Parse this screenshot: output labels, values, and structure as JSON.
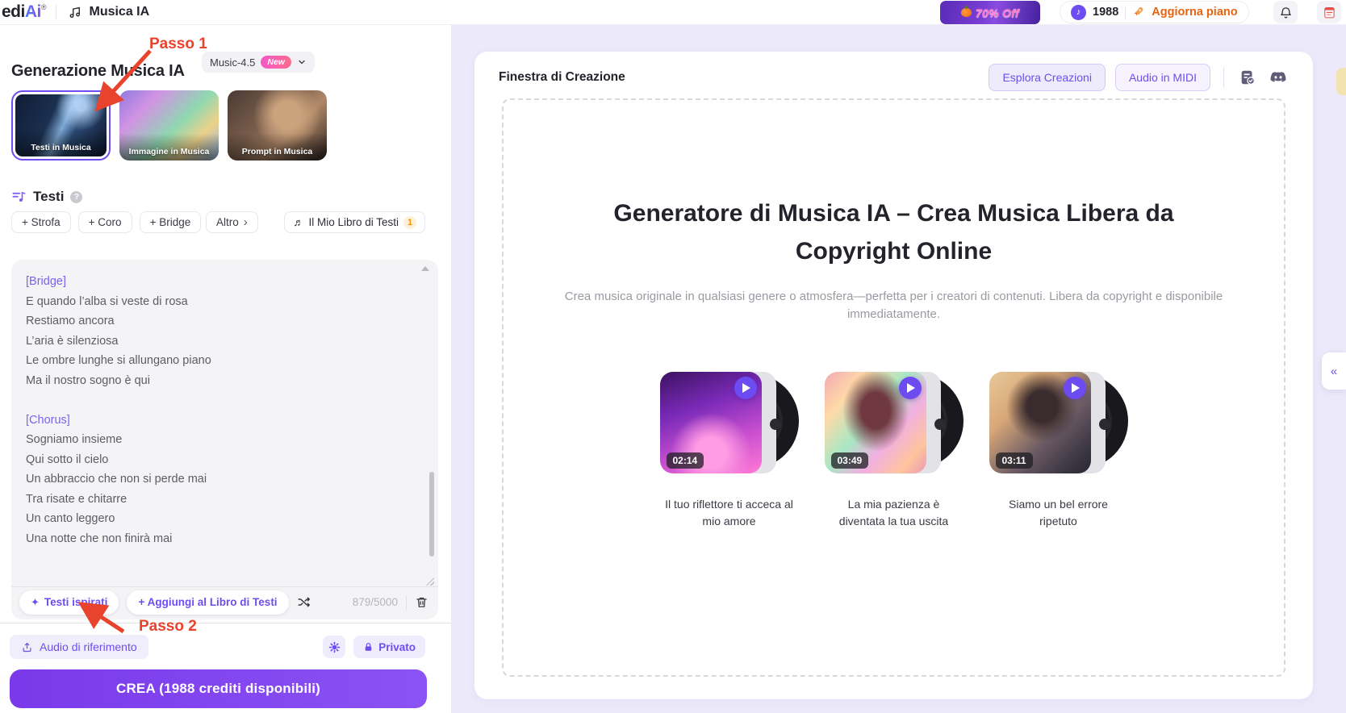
{
  "colors": {
    "accent": "#6d4df2",
    "annotation_red": "#e8432d",
    "upgrade_orange": "#e8630f",
    "promo_pink": "#ff6fc8",
    "lavender_bg": "#ebe9fa"
  },
  "topbar": {
    "logo_prefix": "edi",
    "logo_accent": "Ai",
    "logo_reg": "®",
    "app_title": "Musica IA",
    "promo_label": "70% Off",
    "credits": "1988",
    "upgrade_label": "Aggiorna piano",
    "note_glyph": "♪"
  },
  "sidebar": {
    "step1_label": "Passo 1",
    "step2_label": "Passo 2",
    "heading": "Generazione Musica IA",
    "model_name": "Music-4.5",
    "model_badge": "New",
    "modes": [
      "Testi in Musica",
      "Immagine in Musica",
      "Prompt in Musica"
    ],
    "section_title": "Testi",
    "help_glyph": "?",
    "chips": [
      "+ Strofa",
      "+ Coro",
      "+ Bridge"
    ],
    "more_label": "Altro",
    "more_chevron": "›",
    "library_label": "Il Mio Libro di Testi",
    "library_count": "1",
    "library_icon_glyph": "♬",
    "lyrics_lines": [
      "[Bridge]",
      "E quando l’alba si veste di rosa",
      "Restiamo ancora",
      "L’aria è silenziosa",
      "Le ombre lunghe si allungano piano",
      "Ma il nostro sogno è qui",
      "",
      "[Chorus]",
      "Sogniamo insieme",
      "Qui sotto il cielo",
      "Un abbraccio che non si perde mai",
      "Tra risate e chitarre",
      "Un canto leggero",
      "Una notte che non finirà mai"
    ],
    "char_counter": "879/5000",
    "inspired_icon": "✦",
    "inspired_label": "Testi ispirati",
    "add_library_label": "+ Aggiungi al Libro di Testi",
    "reference_label": "Audio di riferimento",
    "private_label": "Privato",
    "create_label": "CREA (1988 crediti disponibili)"
  },
  "main": {
    "window_title": "Finestra di Creazione",
    "explore_label": "Esplora Creazioni",
    "midi_label": "Audio in MIDI",
    "hero_title": "Generatore di Musica IA – Crea Musica Libera da Copyright Online",
    "hero_subtitle": "Crea musica originale in qualsiasi genere o atmosfera—perfetta per i creatori di contenuti. Libera da copyright e disponibile immediatamente.",
    "samples": [
      {
        "duration": "02:14",
        "caption": "Il tuo riflettore ti acceca al mio amore"
      },
      {
        "duration": "03:49",
        "caption": "La mia pazienza è diventata la tua uscita"
      },
      {
        "duration": "03:11",
        "caption": "Siamo un bel errore ripetuto"
      }
    ],
    "collapse_glyph": "«"
  }
}
